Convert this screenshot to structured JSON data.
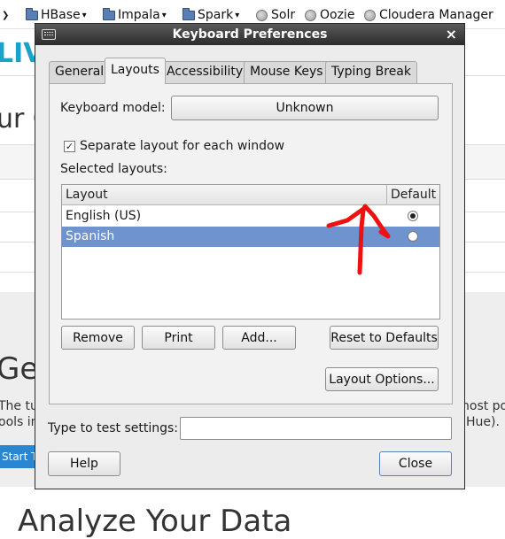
{
  "browser": {
    "bookmarks": [
      {
        "label": "",
        "kind": "chevron-only"
      },
      {
        "label": "HBase",
        "kind": "folder"
      },
      {
        "label": "Impala",
        "kind": "folder"
      },
      {
        "label": "Spark",
        "kind": "folder"
      },
      {
        "label": "Solr",
        "kind": "site"
      },
      {
        "label": "Oozie",
        "kind": "site"
      },
      {
        "label": "Cloudera Manager",
        "kind": "site"
      }
    ],
    "page": {
      "logo_fragment": "LIVE",
      "heading_fragment": "ur C",
      "section_fragment": "Ge",
      "text_left_1": "The tut",
      "text_left_2": "ools in",
      "text_right_1": "nost po",
      "text_right_2": "Hue).",
      "start_button_fragment": "Start T",
      "bottom_fragment": "Analyze Your Data",
      "colors": {
        "logo": "#1aa3c8",
        "start_button": "#2a86d0",
        "section_bg": "#eeeeee"
      }
    }
  },
  "dialog": {
    "title": "Keyboard Preferences",
    "tabs": [
      {
        "label": "General",
        "active": false
      },
      {
        "label": "Layouts",
        "active": true
      },
      {
        "label": "Accessibility",
        "active": false
      },
      {
        "label": "Mouse Keys",
        "active": false
      },
      {
        "label": "Typing Break",
        "active": false
      }
    ],
    "keyboard_model_label": "Keyboard model:",
    "keyboard_model_value": "Unknown",
    "separate_layout_label": "Separate layout for each window",
    "separate_layout_checked": true,
    "selected_layouts_label": "Selected layouts:",
    "list_headers": {
      "layout": "Layout",
      "default": "Default"
    },
    "layouts": [
      {
        "name": "English (US)",
        "default": true,
        "selected": false
      },
      {
        "name": "Spanish",
        "default": false,
        "selected": true
      }
    ],
    "buttons": {
      "remove": "Remove",
      "print": "Print",
      "add": "Add...",
      "reset": "Reset to Defaults",
      "layout_options": "Layout Options...",
      "help": "Help",
      "close": "Close"
    },
    "test_label": "Type to test settings:",
    "test_value": "",
    "close_glyph": "×"
  },
  "annotation_color": "#ee1111"
}
